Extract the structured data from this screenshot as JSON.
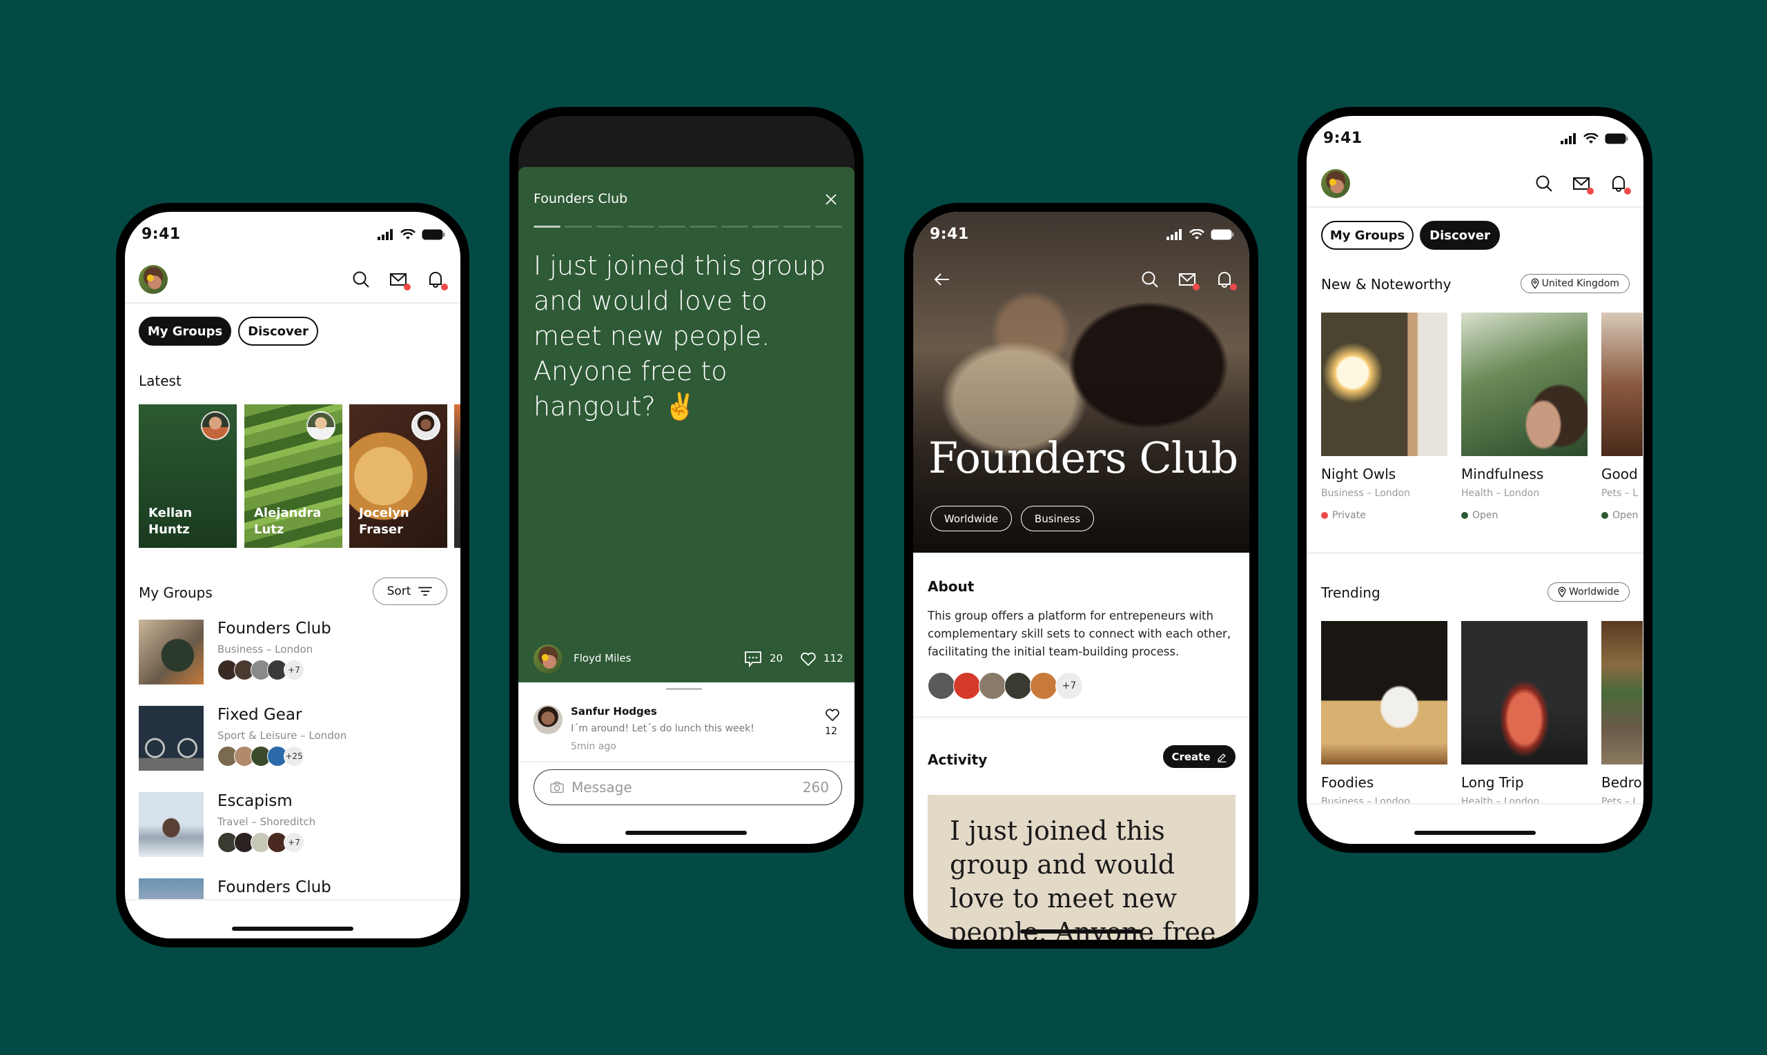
{
  "colors": {
    "background": "#034a44",
    "story_green": "#2e5a36",
    "notification_dot": "#ef4a4a",
    "status_open": "#2e5a36",
    "status_private": "#ef4a4a",
    "beige_card": "#e2d9c7"
  },
  "status_bar": {
    "time": "9:41",
    "icons": [
      "signal-icon",
      "wifi-icon",
      "battery-icon"
    ]
  },
  "header_icons": [
    "search-icon",
    "mail-icon",
    "bell-icon"
  ],
  "phone1": {
    "tabs": [
      {
        "label": "My Groups",
        "active": true
      },
      {
        "label": "Discover",
        "active": false
      }
    ],
    "latest_title": "Latest",
    "latest": [
      {
        "name": "Kellan\nHuntz"
      },
      {
        "name": "Alejandra\nLutz"
      },
      {
        "name": "Jocelyn\nFraser"
      }
    ],
    "my_groups_title": "My Groups",
    "sort_label": "Sort",
    "groups": [
      {
        "title": "Founders Club",
        "subtitle": "Business – London",
        "more": "+7"
      },
      {
        "title": "Fixed Gear",
        "subtitle": "Sport & Leisure – London",
        "more": "+25"
      },
      {
        "title": "Escapism",
        "subtitle": "Travel – Shoreditch",
        "more": "+7"
      },
      {
        "title": "Founders Club",
        "subtitle": "",
        "more": ""
      }
    ]
  },
  "phone2": {
    "group_name": "Founders Club",
    "progress": {
      "total_segments": 10,
      "current": 1
    },
    "post_text": "I just joined this group and would love to meet new people. Anyone free to hangout? ✌️",
    "author": "Floyd Miles",
    "comments_count": "20",
    "likes_count": "112",
    "comment": {
      "author": "Sanfur Hodges",
      "text": "I´m around! Let´s do lunch this week!",
      "time": "5min ago",
      "likes": "12"
    },
    "message_placeholder": "Message",
    "char_count": "260"
  },
  "phone3": {
    "title": "Founders Club",
    "tags": [
      "Worldwide",
      "Business"
    ],
    "about_title": "About",
    "about_text": "This group offers a platform for entrepeneurs with complementary skill sets to connect with each other, facilitating the initial team-building process.",
    "members_more": "+7",
    "activity_title": "Activity",
    "create_label": "Create",
    "activity_post": "I just joined this group and would love to meet new people. Anyone free this"
  },
  "phone4": {
    "tabs": [
      {
        "label": "My Groups",
        "active": false
      },
      {
        "label": "Discover",
        "active": true
      }
    ],
    "new_title": "New & Noteworthy",
    "new_location": "United Kingdom",
    "new_items": [
      {
        "title": "Night Owls",
        "subtitle": "Business – London",
        "status": "Private"
      },
      {
        "title": "Mindfulness",
        "subtitle": "Health – London",
        "status": "Open"
      },
      {
        "title": "Good I",
        "subtitle": "Pets – L",
        "status": "Open"
      }
    ],
    "trending_title": "Trending",
    "trending_location": "Worldwide",
    "trending_items": [
      {
        "title": "Foodies",
        "subtitle": "Business – London"
      },
      {
        "title": "Long Trip",
        "subtitle": "Health – London"
      },
      {
        "title": "Bedro",
        "subtitle": "Pets – L"
      }
    ]
  }
}
